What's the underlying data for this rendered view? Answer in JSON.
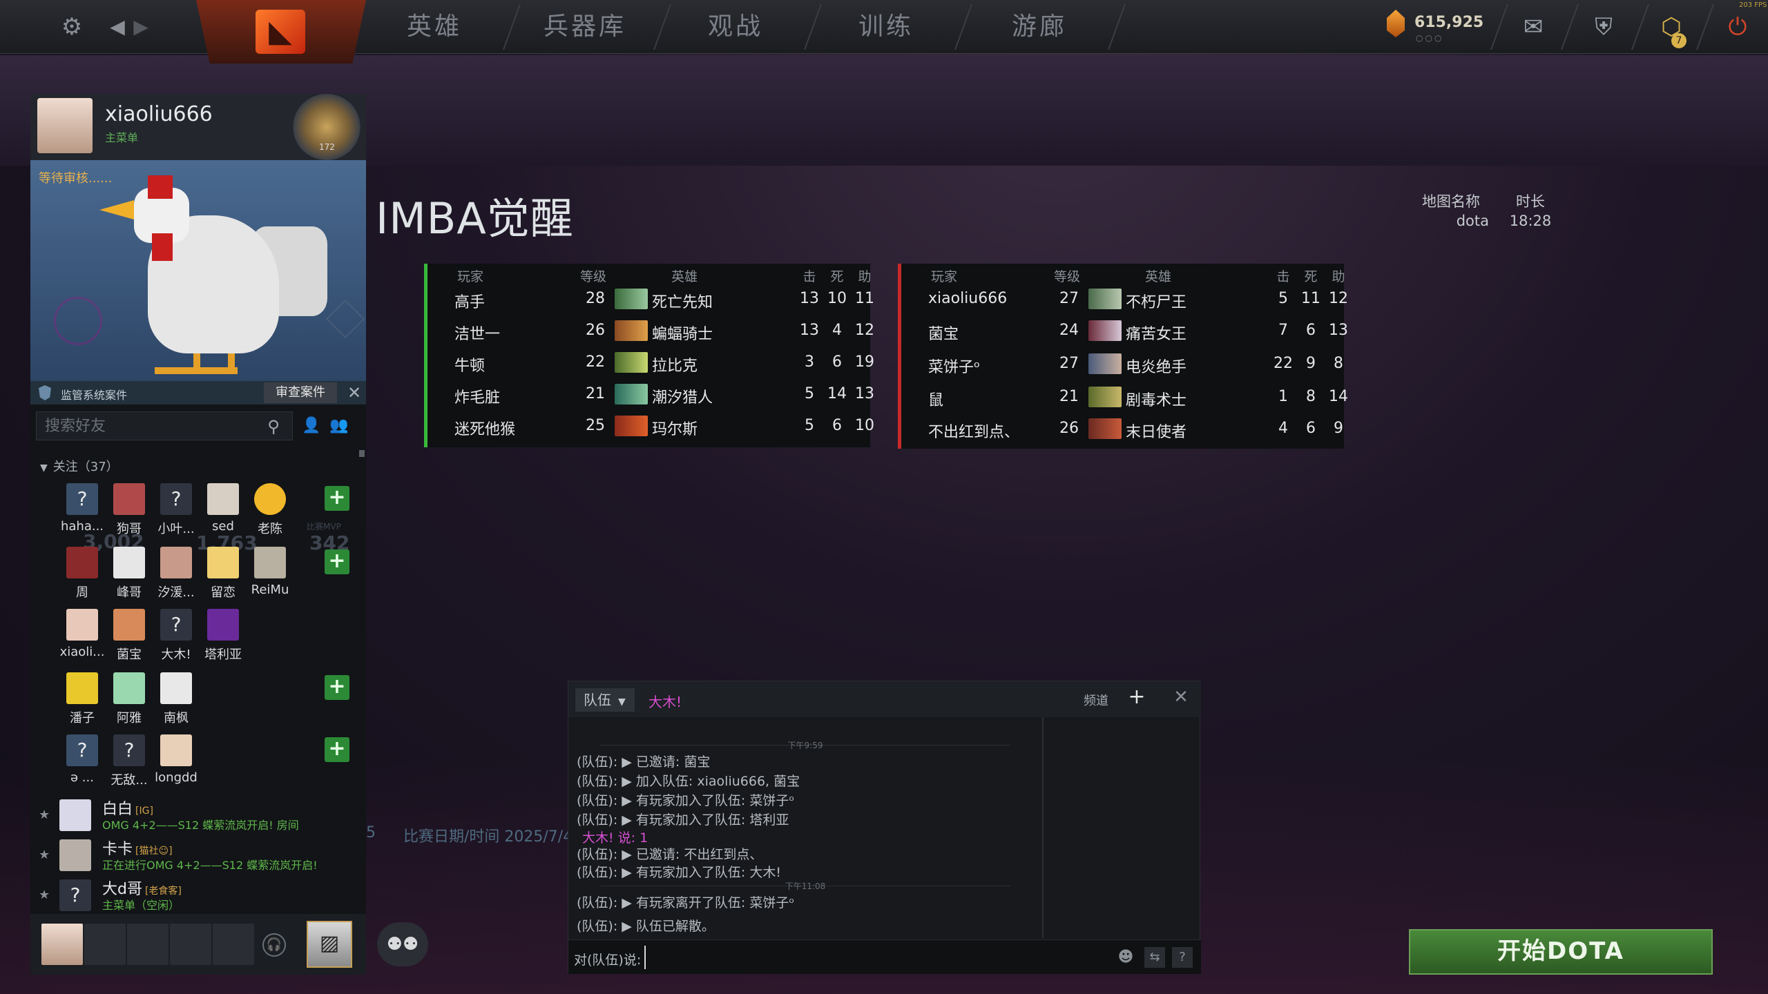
{
  "topbar": {
    "nav": [
      "英雄",
      "兵器库",
      "观战",
      "训练",
      "游廊"
    ],
    "currency": "615,925",
    "currency_dots": "○○○",
    "badge": "7",
    "fps": "203 FPS"
  },
  "profile": {
    "name": "xiaoliu666",
    "subtitle": "主菜单",
    "rank_number": "172",
    "pending": "等待审核......"
  },
  "sidebar": {
    "monitor_label": "监管系统案件",
    "review_button": "审查案件",
    "search_placeholder": "搜索好友",
    "group_header": "关注（37）",
    "ghost_values": [
      "3,002",
      "1,763",
      "342"
    ],
    "ghost_label": "比赛MVP",
    "friends": [
      {
        "name": "haha...",
        "glyph": "?"
      },
      {
        "name": "狗哥",
        "glyph": ""
      },
      {
        "name": "小叶...",
        "glyph": "?"
      },
      {
        "name": "sed",
        "glyph": ""
      },
      {
        "name": "老陈",
        "glyph": ""
      },
      {
        "name": "周",
        "glyph": ""
      },
      {
        "name": "峰哥",
        "glyph": ""
      },
      {
        "name": "汐湲...",
        "glyph": ""
      },
      {
        "name": "留恋",
        "glyph": ""
      },
      {
        "name": "ReiMu",
        "glyph": ""
      },
      {
        "name": "xiaoli...",
        "glyph": ""
      },
      {
        "name": "菌宝",
        "glyph": ""
      },
      {
        "name": "大木!",
        "glyph": "?"
      },
      {
        "name": "塔利亚",
        "glyph": ""
      },
      {
        "name": "潘子",
        "glyph": ""
      },
      {
        "name": "阿雅",
        "glyph": ""
      },
      {
        "name": "南枫",
        "glyph": ""
      },
      {
        "name": "ə ...",
        "glyph": "?"
      },
      {
        "name": "无敌...",
        "glyph": "?"
      },
      {
        "name": "longdd",
        "glyph": ""
      }
    ],
    "favorites": [
      {
        "name": "白白",
        "tag": "[IG]",
        "status": "OMG 4+2——S12 蝶萦流岚开启! 房间"
      },
      {
        "name": "卡卡",
        "tag": "[猫社☺]",
        "status": "正在进行OMG 4+2——S12 蝶萦流岚开启!"
      },
      {
        "name": "大d哥",
        "tag": "[老食客]",
        "status": "主菜单（空闲）",
        "glyph": "?"
      }
    ]
  },
  "match": {
    "title": "IMBA觉醒",
    "map_label": "地图名称",
    "map_value": "dota",
    "duration_label": "时长",
    "duration_value": "18:28",
    "ghost_date": "比赛日期/时间 2025/7/4",
    "ghost_digit": "5",
    "headers": {
      "player": "玩家",
      "level": "等级",
      "hero": "英雄",
      "k": "击",
      "d": "死",
      "a": "助"
    },
    "radiant": [
      {
        "player": "高手",
        "level": "28",
        "hero": "死亡先知",
        "k": "13",
        "d": "10",
        "a": "11",
        "color": "#3a6a3a"
      },
      {
        "player": "洁世一",
        "level": "26",
        "hero": "蝙蝠骑士",
        "k": "13",
        "d": "4",
        "a": "12",
        "color": "#8a4a22"
      },
      {
        "player": "牛顿",
        "level": "22",
        "hero": "拉比克",
        "k": "3",
        "d": "6",
        "a": "19",
        "color": "#4a6a2a"
      },
      {
        "player": "炸毛脏",
        "level": "21",
        "hero": "潮汐猎人",
        "k": "5",
        "d": "14",
        "a": "13",
        "color": "#2a6a5a"
      },
      {
        "player": "迷死他猴",
        "level": "25",
        "hero": "玛尔斯",
        "k": "5",
        "d": "6",
        "a": "10",
        "color": "#8a2a1a"
      }
    ],
    "dire": [
      {
        "player": "xiaoliu666",
        "level": "27",
        "hero": "不朽尸王",
        "k": "5",
        "d": "11",
        "a": "12",
        "color": "#4a6a4a"
      },
      {
        "player": "菌宝",
        "level": "24",
        "hero": "痛苦女王",
        "k": "7",
        "d": "6",
        "a": "13",
        "color": "#6a2a3a"
      },
      {
        "player": "菜饼子ᵒ",
        "level": "27",
        "hero": "电炎绝手",
        "k": "22",
        "d": "9",
        "a": "8",
        "color": "#4a5a7a"
      },
      {
        "player": "鼠",
        "level": "21",
        "hero": "剧毒术士",
        "k": "1",
        "d": "8",
        "a": "14",
        "color": "#5a6a2a"
      },
      {
        "player": "不出红到点、",
        "level": "26",
        "hero": "末日使者",
        "k": "4",
        "d": "6",
        "a": "9",
        "color": "#6a2a22"
      }
    ]
  },
  "chat": {
    "tab": "队伍",
    "active_name": "大木!",
    "channel": "频道",
    "timestamps": [
      "下午9:59",
      "下午11:08"
    ],
    "messages": [
      {
        "prefix": "(队伍):",
        "text": "▶ 已邀请: 菌宝"
      },
      {
        "prefix": "(队伍):",
        "text": "▶ 加入队伍: xiaoliu666, 菌宝"
      },
      {
        "prefix": "(队伍):",
        "text": "▶ 有玩家加入了队伍: 菜饼子ᵒ"
      },
      {
        "prefix": "(队伍):",
        "text": "▶ 有玩家加入了队伍: 塔利亚"
      },
      {
        "prefix": "大木!",
        "text": "说: 1"
      },
      {
        "prefix": "(队伍):",
        "text": "▶ 已邀请: 不出红到点、"
      },
      {
        "prefix": "(队伍):",
        "text": "▶ 有玩家加入了队伍: 大木!"
      },
      {
        "prefix": "(队伍):",
        "text": "▶ 有玩家离开了队伍: 菜饼子ᵒ"
      },
      {
        "prefix": "(队伍):",
        "text": "▶ 队伍已解散。"
      }
    ],
    "input_prefix": "对(队伍)说:",
    "input_value": ""
  },
  "play_button": "开始DOTA"
}
